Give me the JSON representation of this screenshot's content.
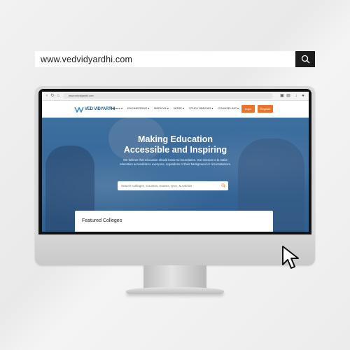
{
  "address_bar": {
    "url": "www.vedvidyardhi.com"
  },
  "browser": {
    "mini_url": "www.vedvidyardhi.com"
  },
  "site": {
    "logo_text": "VED VIDYARTHI",
    "nav": [
      "Courses ▾",
      "ENGINEERING ▾",
      "MEDICAL ▾",
      "MORE ▾",
      "STUDY ABROAD ▾",
      "COUNSELING ▾"
    ],
    "login_label": "Login",
    "register_label": "Register",
    "accent": "#e8732c",
    "brand": "#1f5c94"
  },
  "hero": {
    "title_line1": "Making Education",
    "title_line2": "Accessible and Inspiring",
    "subtitle": "We believe that education should know no boundaries. Our mission is to make education accessible to everyone, regardless of their background or circumstances.",
    "search_placeholder": "Search Colleges, Courses, Exams, QnA, & Articles"
  },
  "featured": {
    "title": "Featured Colleges"
  }
}
